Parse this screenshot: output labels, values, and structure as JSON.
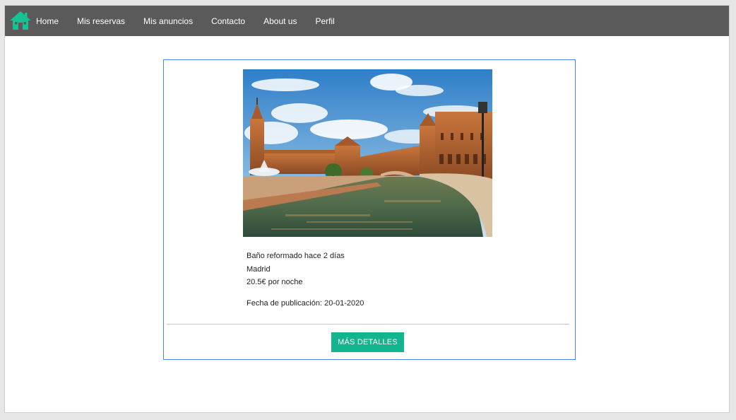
{
  "navbar": {
    "logo_icon": "home-icon",
    "logo_color": "#16c194",
    "background": "#5a5a5a",
    "links": [
      "Home",
      "Mis reservas",
      "Mis anuncios",
      "Contacto",
      "About us",
      "Perfil"
    ]
  },
  "listing": {
    "image_subject": "plaza-palace-canal-photo",
    "description": "Baño reformado hace 2 días",
    "city": "Madrid",
    "price": "20.5€ por noche",
    "published": "Fecha de publicación: 20-01-2020",
    "details_button": "MÁS DETALLES",
    "button_color": "#13b58e",
    "border_color": "#4a86e8"
  }
}
